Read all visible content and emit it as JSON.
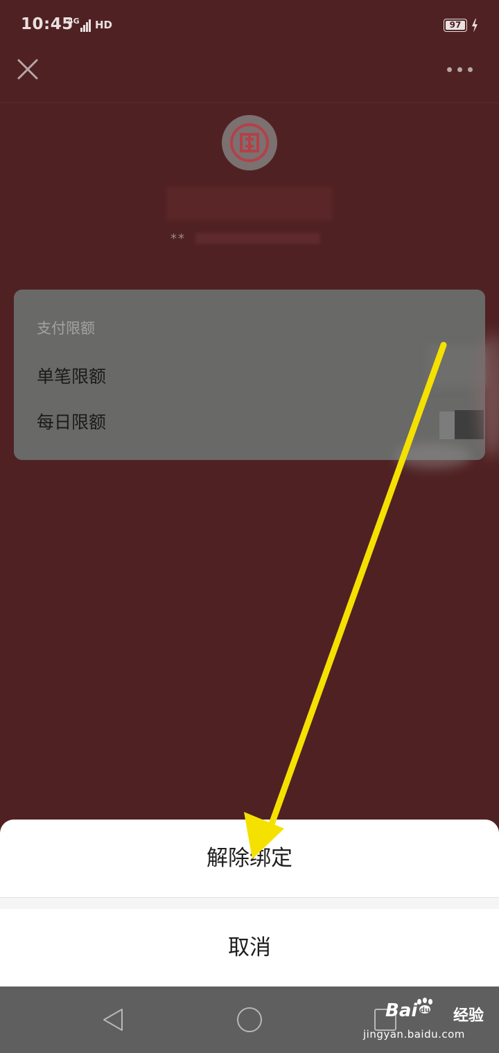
{
  "status_bar": {
    "time": "10:45",
    "network": "4G",
    "hd": "HD",
    "battery": "97"
  },
  "header": {
    "close_icon": "close-icon",
    "more_icon": "more-icon"
  },
  "bank_card": {
    "logo_icon": "icbc-logo",
    "card_number_prefix": "**"
  },
  "limits": {
    "title": "支付限额",
    "single_label": "单笔限额",
    "daily_label": "每日限额"
  },
  "action_sheet": {
    "unbind_label": "解除绑定",
    "cancel_label": "取消"
  },
  "nav": {
    "back_icon": "back-triangle-icon",
    "home_icon": "home-circle-icon",
    "recent_icon": "recent-square-icon"
  },
  "watermark": {
    "brand": "Bai",
    "brand_cn": "经验",
    "url": "jingyan.baidu.com"
  },
  "colors": {
    "overlay_bg": "#502123",
    "annotation_arrow": "#f5e100"
  }
}
